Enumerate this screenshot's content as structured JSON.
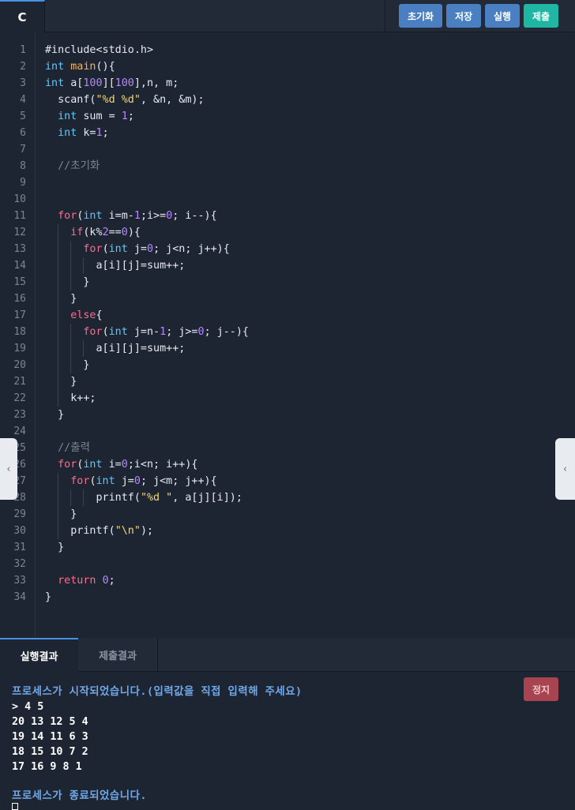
{
  "header": {
    "language_tab": "C",
    "buttons": {
      "reset": "초기화",
      "save": "저장",
      "run": "실행",
      "submit": "제출"
    }
  },
  "editor": {
    "line_numbers": [
      "1",
      "2",
      "3",
      "4",
      "5",
      "6",
      "7",
      "8",
      "9",
      "10",
      "11",
      "12",
      "13",
      "14",
      "15",
      "16",
      "17",
      "18",
      "19",
      "20",
      "21",
      "22",
      "23",
      "24",
      "25",
      "26",
      "27",
      "28",
      "29",
      "30",
      "31",
      "32",
      "33",
      "34"
    ],
    "code": [
      "#include<stdio.h>",
      "int main(){",
      "int a[100][100],n, m;",
      "  scanf(\"%d %d\", &n, &m);",
      "  int sum = 1;",
      "  int k=1;",
      "",
      "  //초기화",
      "",
      "",
      "  for(int i=m-1;i>=0; i--){",
      "    if(k%2==0){",
      "      for(int j=0; j<n; j++){",
      "        a[i][j]=sum++;",
      "      }",
      "    }",
      "    else{",
      "      for(int j=n-1; j>=0; j--){",
      "        a[i][j]=sum++;",
      "      }",
      "    }",
      "    k++;",
      "  }",
      "",
      "  //출력",
      "  for(int i=0;i<n; i++){",
      "    for(int j=0; j<m; j++){",
      "        printf(\"%d \", a[j][i]);",
      "    }",
      "    printf(\"\\n\");",
      "  }",
      "",
      "  return 0;",
      "}"
    ]
  },
  "output": {
    "tabs": {
      "run_result": "실행결과",
      "submit_result": "제출결과"
    },
    "stop_button": "정지",
    "lines": [
      "프로세스가 시작되었습니다.(입력값을 직접 입력해 주세요)",
      "> 4 5",
      "20 13 12 5 4",
      "19 14 11 6 3",
      "18 15 10 7 2",
      "17 16 9 8 1",
      "",
      "프로세스가 종료되었습니다."
    ]
  },
  "side_arrows": {
    "left": "‹",
    "right": "‹"
  },
  "colors": {
    "background": "#1e2532",
    "accent": "#4a90e2",
    "submit": "#1fb6a4",
    "stop": "#a84450"
  }
}
